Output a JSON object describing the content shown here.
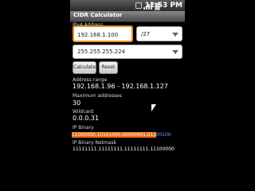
{
  "status": {
    "time": "12:53 PM",
    "icons": [
      "usb-icon",
      "network-icon",
      "battery-icon"
    ]
  },
  "app": {
    "title": "CIDR Calculator"
  },
  "form": {
    "ip_label": "IPv4 Address",
    "ip_value": "192.168.1.100",
    "prefix_selected": "/27",
    "mask_selected": "255.255.255.224",
    "calculate_label": "Calculate",
    "reset_label": "Reset"
  },
  "results": {
    "range_label": "Address range",
    "range_value": "192.168.1.96 - 192.168.1.127",
    "max_label": "Maximum addresses",
    "max_value": "30",
    "wildcard_label": "Wildcard",
    "wildcard_value": "0.0.0.31",
    "binary_label": "IP Binary",
    "binary_network_part": "11000000.10101000.00000001.011",
    "binary_host_part": "00100",
    "netmask_label": "IP Binary Netmask",
    "netmask_value": "11111111.11111111.11111111.11100000"
  },
  "colors": {
    "accent": "#f08a1c",
    "network_highlight": "#e56a10",
    "host_bits": "#6aa0ff"
  }
}
